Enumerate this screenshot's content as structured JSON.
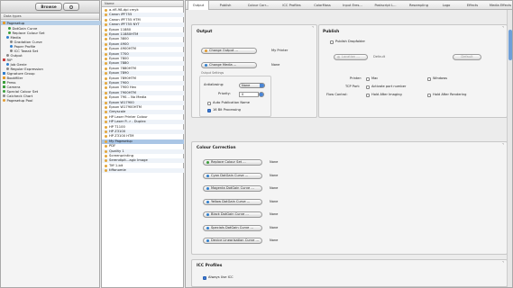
{
  "left_panel": {
    "browse_tab": "Browse",
    "search_icon": "search-icon",
    "header": "Data types",
    "items": [
      {
        "label": "Pagesetup",
        "color": "#e29b2f",
        "selected": true
      },
      {
        "label": "DotGain Curve",
        "color": "#3a9e3a"
      },
      {
        "label": "Replace Colour Set",
        "color": "#3a9e3a"
      },
      {
        "label": "Media",
        "color": "#2f7fce"
      },
      {
        "label": "Gradation Curve",
        "color": "#888888"
      },
      {
        "label": "Paper Profile",
        "color": "#2f7fce"
      },
      {
        "label": "ICC Tweak Set",
        "color": "#888888"
      },
      {
        "label": "Output",
        "color": "#888888"
      },
      {
        "label": "RIP",
        "color": "#c94040"
      },
      {
        "label": "Job Genie",
        "color": "#2f7fce"
      },
      {
        "label": "Regular Expression",
        "color": "#888888"
      },
      {
        "label": "Signature Group",
        "color": "#2f7fce"
      },
      {
        "label": "Bookfiller",
        "color": "#e29b2f"
      },
      {
        "label": "Press",
        "color": "#3a9e3a"
      },
      {
        "label": "Camera",
        "color": "#3a9e3a"
      },
      {
        "label": "Special Colour Set",
        "color": "#3a9e3a"
      },
      {
        "label": "Calcheck Chart",
        "color": "#888888"
      },
      {
        "label": "Pagesetup Pool",
        "color": "#e29b2f"
      }
    ]
  },
  "middle_panel": {
    "header": "Name",
    "items": [
      "a-rifl-98-dpi cmyk",
      "Canon iPF755",
      "Canon iPF755 HTM",
      "Canon iPF755 NYT",
      "Epson 11880",
      "Epson 11880HTM",
      "Epson 3800",
      "Epson 4900",
      "Epson 4900HTM",
      "Epson 7700",
      "Epson 7800",
      "Epson 7880",
      "Epson 7880HTM",
      "Epson 7890",
      "Epson 7890HTM",
      "Epson 7900",
      "Epson 7900 Hex",
      "Epson 7900HTM",
      "Epson 790... No Media",
      "Epson W17900",
      "Epson W17900HTM",
      "Greyscale",
      "HP Laser Printer Colour",
      "HP Laser P...r - Duplex",
      "HP T1100",
      "HP Z3100",
      "HP Z3100 HTM",
      "My Pagesetup",
      "PDF",
      "Quality 1",
      "Screenprinting",
      "Serendipit...agic Image",
      "Tiff 1-bit",
      "tiffonomie"
    ],
    "selected_index": 27
  },
  "tabs": [
    "Output",
    "Publish",
    "Colour Corr...",
    "ICC Profiles",
    "ColorMass",
    "Input Eres...",
    "Postscript L...",
    "Resampling",
    "Logo",
    "Effects",
    "Media Effects"
  ],
  "output": {
    "title": "Output",
    "change_output_label": "Change Output ...",
    "output_value": "My Printer",
    "change_media_label": "Change Media ...",
    "media_value": "None",
    "settings_title": "Output Settings",
    "antialiasing_label": "Antialiasing:",
    "antialiasing_value": "None",
    "priority_label": "Priority:",
    "priority_value": "0",
    "auto_pub_label": "Auto Publication Name",
    "bit16_label": "16 Bit Processing"
  },
  "publish": {
    "title": "Publish",
    "dropfolder_label": "Publish Dropfolder",
    "location_label": "Location ...",
    "location_value": "Default",
    "default_btn": "Default",
    "printer_label": "Printer:",
    "mac_label": "Mac",
    "windows_label": "Windows",
    "tcp_label": "TCP Port:",
    "tcp_check_label": "Activate port number",
    "flow_label": "Flow Control:",
    "hold_imaging_label": "Hold After Imaging",
    "hold_render_label": "Hold After Rendering"
  },
  "colour_correction": {
    "title": "Colour Correction",
    "rows": [
      {
        "label": "Replace Colour Set ...",
        "value": "None",
        "color": "#3a9e3a"
      },
      {
        "label": "Cyan DotGain Curve ...",
        "value": "None",
        "color": "#2f7fce"
      },
      {
        "label": "Magenta DotGain Curve ...",
        "value": "None",
        "color": "#2f7fce"
      },
      {
        "label": "Yellow DotGain Curve ...",
        "value": "None",
        "color": "#2f7fce"
      },
      {
        "label": "Black DotGain Curve ...",
        "value": "None",
        "color": "#2f7fce"
      },
      {
        "label": "Specials DotGain Curve ...",
        "value": "None",
        "color": "#2f7fce"
      },
      {
        "label": "Device Linearisation Curve ...",
        "value": "None",
        "color": "#2f7fce"
      }
    ]
  },
  "icc": {
    "title": "ICC Profiles",
    "always_use_label": "Always Use ICC"
  }
}
